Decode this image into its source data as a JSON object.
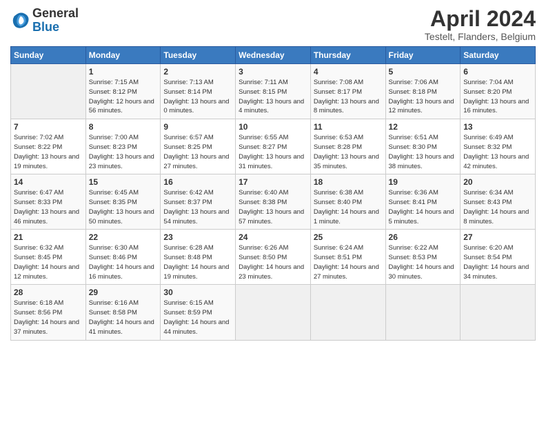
{
  "logo": {
    "text_general": "General",
    "text_blue": "Blue"
  },
  "header": {
    "month_year": "April 2024",
    "location": "Testelt, Flanders, Belgium"
  },
  "weekdays": [
    "Sunday",
    "Monday",
    "Tuesday",
    "Wednesday",
    "Thursday",
    "Friday",
    "Saturday"
  ],
  "weeks": [
    [
      {
        "day": "",
        "sunrise": "",
        "sunset": "",
        "daylight": ""
      },
      {
        "day": "1",
        "sunrise": "Sunrise: 7:15 AM",
        "sunset": "Sunset: 8:12 PM",
        "daylight": "Daylight: 12 hours and 56 minutes."
      },
      {
        "day": "2",
        "sunrise": "Sunrise: 7:13 AM",
        "sunset": "Sunset: 8:14 PM",
        "daylight": "Daylight: 13 hours and 0 minutes."
      },
      {
        "day": "3",
        "sunrise": "Sunrise: 7:11 AM",
        "sunset": "Sunset: 8:15 PM",
        "daylight": "Daylight: 13 hours and 4 minutes."
      },
      {
        "day": "4",
        "sunrise": "Sunrise: 7:08 AM",
        "sunset": "Sunset: 8:17 PM",
        "daylight": "Daylight: 13 hours and 8 minutes."
      },
      {
        "day": "5",
        "sunrise": "Sunrise: 7:06 AM",
        "sunset": "Sunset: 8:18 PM",
        "daylight": "Daylight: 13 hours and 12 minutes."
      },
      {
        "day": "6",
        "sunrise": "Sunrise: 7:04 AM",
        "sunset": "Sunset: 8:20 PM",
        "daylight": "Daylight: 13 hours and 16 minutes."
      }
    ],
    [
      {
        "day": "7",
        "sunrise": "Sunrise: 7:02 AM",
        "sunset": "Sunset: 8:22 PM",
        "daylight": "Daylight: 13 hours and 19 minutes."
      },
      {
        "day": "8",
        "sunrise": "Sunrise: 7:00 AM",
        "sunset": "Sunset: 8:23 PM",
        "daylight": "Daylight: 13 hours and 23 minutes."
      },
      {
        "day": "9",
        "sunrise": "Sunrise: 6:57 AM",
        "sunset": "Sunset: 8:25 PM",
        "daylight": "Daylight: 13 hours and 27 minutes."
      },
      {
        "day": "10",
        "sunrise": "Sunrise: 6:55 AM",
        "sunset": "Sunset: 8:27 PM",
        "daylight": "Daylight: 13 hours and 31 minutes."
      },
      {
        "day": "11",
        "sunrise": "Sunrise: 6:53 AM",
        "sunset": "Sunset: 8:28 PM",
        "daylight": "Daylight: 13 hours and 35 minutes."
      },
      {
        "day": "12",
        "sunrise": "Sunrise: 6:51 AM",
        "sunset": "Sunset: 8:30 PM",
        "daylight": "Daylight: 13 hours and 38 minutes."
      },
      {
        "day": "13",
        "sunrise": "Sunrise: 6:49 AM",
        "sunset": "Sunset: 8:32 PM",
        "daylight": "Daylight: 13 hours and 42 minutes."
      }
    ],
    [
      {
        "day": "14",
        "sunrise": "Sunrise: 6:47 AM",
        "sunset": "Sunset: 8:33 PM",
        "daylight": "Daylight: 13 hours and 46 minutes."
      },
      {
        "day": "15",
        "sunrise": "Sunrise: 6:45 AM",
        "sunset": "Sunset: 8:35 PM",
        "daylight": "Daylight: 13 hours and 50 minutes."
      },
      {
        "day": "16",
        "sunrise": "Sunrise: 6:42 AM",
        "sunset": "Sunset: 8:37 PM",
        "daylight": "Daylight: 13 hours and 54 minutes."
      },
      {
        "day": "17",
        "sunrise": "Sunrise: 6:40 AM",
        "sunset": "Sunset: 8:38 PM",
        "daylight": "Daylight: 13 hours and 57 minutes."
      },
      {
        "day": "18",
        "sunrise": "Sunrise: 6:38 AM",
        "sunset": "Sunset: 8:40 PM",
        "daylight": "Daylight: 14 hours and 1 minute."
      },
      {
        "day": "19",
        "sunrise": "Sunrise: 6:36 AM",
        "sunset": "Sunset: 8:41 PM",
        "daylight": "Daylight: 14 hours and 5 minutes."
      },
      {
        "day": "20",
        "sunrise": "Sunrise: 6:34 AM",
        "sunset": "Sunset: 8:43 PM",
        "daylight": "Daylight: 14 hours and 8 minutes."
      }
    ],
    [
      {
        "day": "21",
        "sunrise": "Sunrise: 6:32 AM",
        "sunset": "Sunset: 8:45 PM",
        "daylight": "Daylight: 14 hours and 12 minutes."
      },
      {
        "day": "22",
        "sunrise": "Sunrise: 6:30 AM",
        "sunset": "Sunset: 8:46 PM",
        "daylight": "Daylight: 14 hours and 16 minutes."
      },
      {
        "day": "23",
        "sunrise": "Sunrise: 6:28 AM",
        "sunset": "Sunset: 8:48 PM",
        "daylight": "Daylight: 14 hours and 19 minutes."
      },
      {
        "day": "24",
        "sunrise": "Sunrise: 6:26 AM",
        "sunset": "Sunset: 8:50 PM",
        "daylight": "Daylight: 14 hours and 23 minutes."
      },
      {
        "day": "25",
        "sunrise": "Sunrise: 6:24 AM",
        "sunset": "Sunset: 8:51 PM",
        "daylight": "Daylight: 14 hours and 27 minutes."
      },
      {
        "day": "26",
        "sunrise": "Sunrise: 6:22 AM",
        "sunset": "Sunset: 8:53 PM",
        "daylight": "Daylight: 14 hours and 30 minutes."
      },
      {
        "day": "27",
        "sunrise": "Sunrise: 6:20 AM",
        "sunset": "Sunset: 8:54 PM",
        "daylight": "Daylight: 14 hours and 34 minutes."
      }
    ],
    [
      {
        "day": "28",
        "sunrise": "Sunrise: 6:18 AM",
        "sunset": "Sunset: 8:56 PM",
        "daylight": "Daylight: 14 hours and 37 minutes."
      },
      {
        "day": "29",
        "sunrise": "Sunrise: 6:16 AM",
        "sunset": "Sunset: 8:58 PM",
        "daylight": "Daylight: 14 hours and 41 minutes."
      },
      {
        "day": "30",
        "sunrise": "Sunrise: 6:15 AM",
        "sunset": "Sunset: 8:59 PM",
        "daylight": "Daylight: 14 hours and 44 minutes."
      },
      {
        "day": "",
        "sunrise": "",
        "sunset": "",
        "daylight": ""
      },
      {
        "day": "",
        "sunrise": "",
        "sunset": "",
        "daylight": ""
      },
      {
        "day": "",
        "sunrise": "",
        "sunset": "",
        "daylight": ""
      },
      {
        "day": "",
        "sunrise": "",
        "sunset": "",
        "daylight": ""
      }
    ]
  ]
}
